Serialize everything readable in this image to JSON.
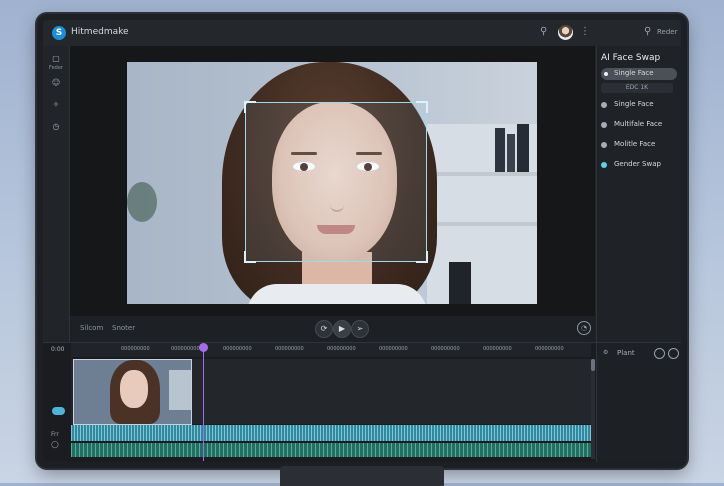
{
  "app": {
    "title": "Hitmedmake",
    "logo_letter": "S"
  },
  "topbar": {
    "right_label": "Reder"
  },
  "rail": {
    "items": [
      "▢",
      "☺",
      "✧",
      "◷"
    ],
    "first_label": "Feder"
  },
  "preview": {},
  "transport": {
    "left_label": "Silcom",
    "mid_label": "Snoter",
    "rewind": "⟳",
    "play": "▶",
    "forward": "➢",
    "right_icon": "◔"
  },
  "panel": {
    "title": "AI Face Swap",
    "options": [
      {
        "label": "Single Face",
        "selected": true
      },
      {
        "label": "Single Face",
        "selected": false
      },
      {
        "label": "Multifale Face",
        "selected": false
      },
      {
        "label": "Molitle Face",
        "selected": false
      },
      {
        "label": "Gender Swap",
        "selected": false
      }
    ],
    "sub_field": "EDC 1K",
    "accent": "#5fd0e6"
  },
  "timeline": {
    "start": "0:00",
    "ticks": [
      "000000000",
      "000000000",
      "000000000",
      "000000000",
      "000000000",
      "000000000",
      "000000000",
      "000000000",
      "000000000"
    ],
    "right_label": "Plant",
    "track_label": "Frr"
  }
}
